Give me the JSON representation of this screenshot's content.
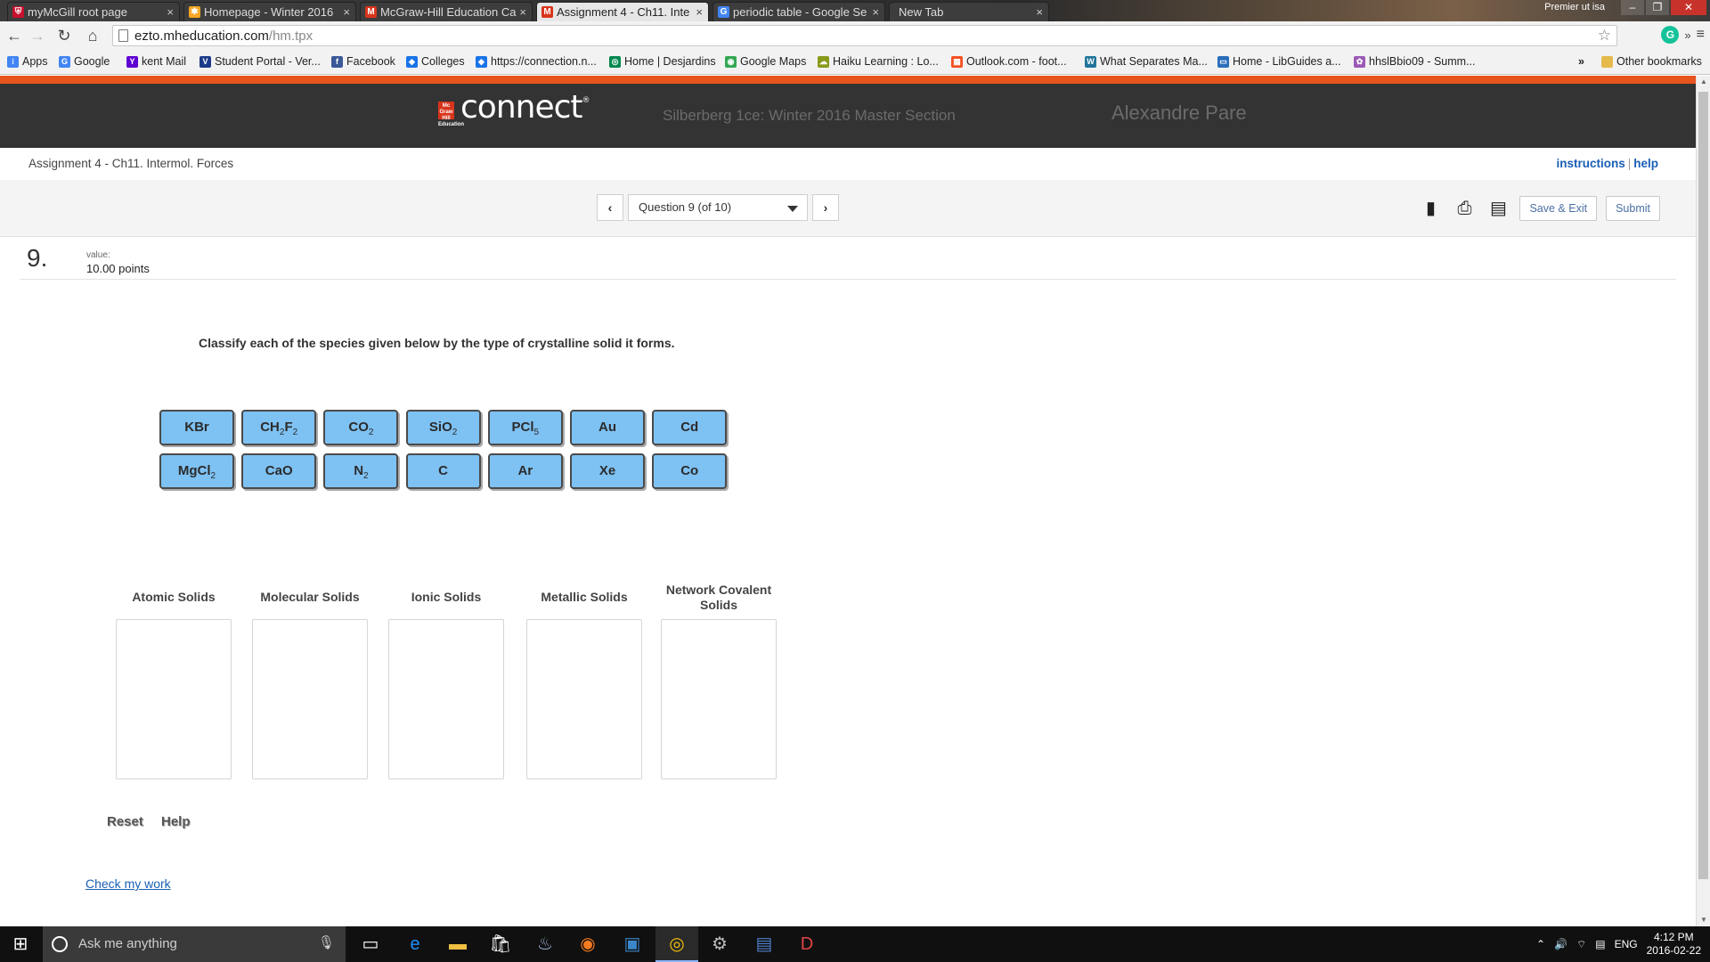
{
  "browser": {
    "tabs": [
      {
        "title": "myMcGill root page",
        "icon": "mcgill-shield-icon",
        "color": "#c8102e",
        "glyph": "⛨"
      },
      {
        "title": "Homepage - Winter 2016",
        "icon": "asterisk-logo-icon",
        "color": "#f6a623",
        "glyph": "✱"
      },
      {
        "title": "McGraw-Hill Education Ca",
        "icon": "mcgraw-hill-icon",
        "color": "#d8341c",
        "glyph": "M"
      },
      {
        "title": "Assignment 4 - Ch11. Inte",
        "icon": "mcgraw-m-icon",
        "color": "#d8341c",
        "glyph": "M"
      },
      {
        "title": "periodic table - Google Se",
        "icon": "google-icon",
        "color": "#4285f4",
        "glyph": "G"
      },
      {
        "title": "New Tab",
        "icon": "",
        "color": "",
        "glyph": ""
      }
    ],
    "active_tab": 3,
    "window_label": "Premier ut isa",
    "url_host": "ezto.mheducation.com",
    "url_path": "/hm.tpx"
  },
  "bookmarks": [
    {
      "label": "Apps",
      "icon": "apps-grid-icon",
      "color": "#4285f4",
      "glyph": "⁝"
    },
    {
      "label": "Google",
      "icon": "google-icon",
      "color": "#4285f4",
      "glyph": "G"
    },
    {
      "label": "kent Mail",
      "icon": "yahoo-icon",
      "color": "#5f01d1",
      "glyph": "Y"
    },
    {
      "label": "Student Portal - Ver...",
      "icon": "vanier-icon",
      "color": "#1b3a8a",
      "glyph": "V"
    },
    {
      "label": "Facebook",
      "icon": "facebook-icon",
      "color": "#3b5998",
      "glyph": "f"
    },
    {
      "label": "Colleges",
      "icon": "colleges-icon",
      "color": "#1a73e8",
      "glyph": "◆"
    },
    {
      "label": "https://connection.n...",
      "icon": "connection-icon",
      "color": "#1a73e8",
      "glyph": "◆"
    },
    {
      "label": "Home | Desjardins",
      "icon": "desjardins-icon",
      "color": "#00874e",
      "glyph": "◎"
    },
    {
      "label": "Google Maps",
      "icon": "maps-icon",
      "color": "#34a853",
      "glyph": "◉"
    },
    {
      "label": "Haiku Learning : Lo...",
      "icon": "haiku-icon",
      "color": "#8a9a1b",
      "glyph": "☁"
    },
    {
      "label": "Outlook.com - foot...",
      "icon": "outlook-icon",
      "color": "#f25022",
      "glyph": "▦"
    },
    {
      "label": "What Separates Ma...",
      "icon": "wordpress-icon",
      "color": "#21759b",
      "glyph": "W"
    },
    {
      "label": "Home - LibGuides a...",
      "icon": "libguides-icon",
      "color": "#2a6ebb",
      "glyph": "▭"
    },
    {
      "label": "hhslBbio09 - Summ...",
      "icon": "hhs-icon",
      "color": "#9b59b6",
      "glyph": "✿"
    }
  ],
  "bookmarks_more": "»",
  "other_bookmarks": "Other bookmarks",
  "header": {
    "logo_text": "connect",
    "logo_mark": "Mc Graw Hill Education",
    "course": "Silberberg 1ce: Winter 2016 Master Section",
    "user": "Alexandre Pare"
  },
  "assignment": {
    "title": "Assignment 4 - Ch11. Intermol. Forces",
    "link_instructions": "instructions",
    "link_separator": "|",
    "link_help": "help"
  },
  "question_nav": {
    "current": "Question 9 (of 10)",
    "save_exit": "Save & Exit",
    "submit": "Submit"
  },
  "question": {
    "number": "9.",
    "value_label": "value:",
    "value": "10.00 points",
    "prompt": "Classify each of the species given below by the type of crystalline solid it forms."
  },
  "species": [
    {
      "base": "KBr",
      "parts": [
        [
          "KBr",
          ""
        ]
      ]
    },
    {
      "base": "CH2F2",
      "parts": [
        [
          "CH",
          "2"
        ],
        [
          "F",
          "2"
        ]
      ]
    },
    {
      "base": "CO2",
      "parts": [
        [
          "CO",
          "2"
        ]
      ]
    },
    {
      "base": "SiO2",
      "parts": [
        [
          "SiO",
          "2"
        ]
      ]
    },
    {
      "base": "PCl5",
      "parts": [
        [
          "PCl",
          "5"
        ]
      ]
    },
    {
      "base": "Au",
      "parts": [
        [
          "Au",
          ""
        ]
      ]
    },
    {
      "base": "Cd",
      "parts": [
        [
          "Cd",
          ""
        ]
      ]
    },
    {
      "base": "MgCl2",
      "parts": [
        [
          "MgCl",
          "2"
        ]
      ]
    },
    {
      "base": "CaO",
      "parts": [
        [
          "CaO",
          ""
        ]
      ]
    },
    {
      "base": "N2",
      "parts": [
        [
          "N",
          "2"
        ]
      ]
    },
    {
      "base": "C",
      "parts": [
        [
          "C",
          ""
        ]
      ]
    },
    {
      "base": "Ar",
      "parts": [
        [
          "Ar",
          ""
        ]
      ]
    },
    {
      "base": "Xe",
      "parts": [
        [
          "Xe",
          ""
        ]
      ]
    },
    {
      "base": "Co",
      "parts": [
        [
          "Co",
          ""
        ]
      ]
    }
  ],
  "categories": [
    {
      "label": "Atomic Solids"
    },
    {
      "label": "Molecular Solids"
    },
    {
      "label": "Ionic Solids"
    },
    {
      "label": "Metallic Solids"
    },
    {
      "label": "Network Covalent Solids"
    }
  ],
  "actions": {
    "reset": "Reset",
    "help": "Help",
    "check": "Check my work"
  },
  "taskbar": {
    "search_placeholder": "Ask me anything",
    "language": "ENG",
    "time": "4:12 PM",
    "date": "2016-02-22"
  },
  "colors": {
    "chip_fill": "#7ec1f3",
    "header_bg": "#333333",
    "brand_orange": "#e8541e",
    "link": "#1a5fb4"
  }
}
